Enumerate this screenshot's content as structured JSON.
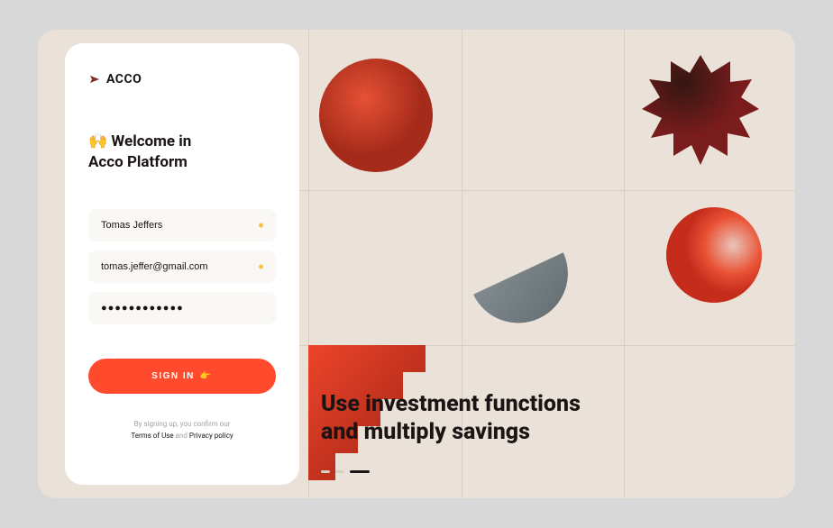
{
  "brand": {
    "name": "ACCO"
  },
  "login": {
    "welcome_prefix": "🙌 Welcome in",
    "welcome_platform": "Acco Platform",
    "name_value": "Tomas Jeffers",
    "email_value": "tomas.jeffer@gmail.com",
    "password_value": "●●●●●●●●●●●●",
    "signin_label": "SIGN IN",
    "disclaimer_prefix": "By signing up, you confirm our",
    "terms_label": "Terms of Use",
    "and_label": "and",
    "privacy_label": "Privacy policy"
  },
  "marketing": {
    "headline_line1": "Use investment functions",
    "headline_line2": "and multiply savings"
  },
  "colors": {
    "accent": "#ff4a2e",
    "dark": "#1a1514",
    "background": "#eae2d8",
    "yellow_dot": "#f5c542"
  }
}
